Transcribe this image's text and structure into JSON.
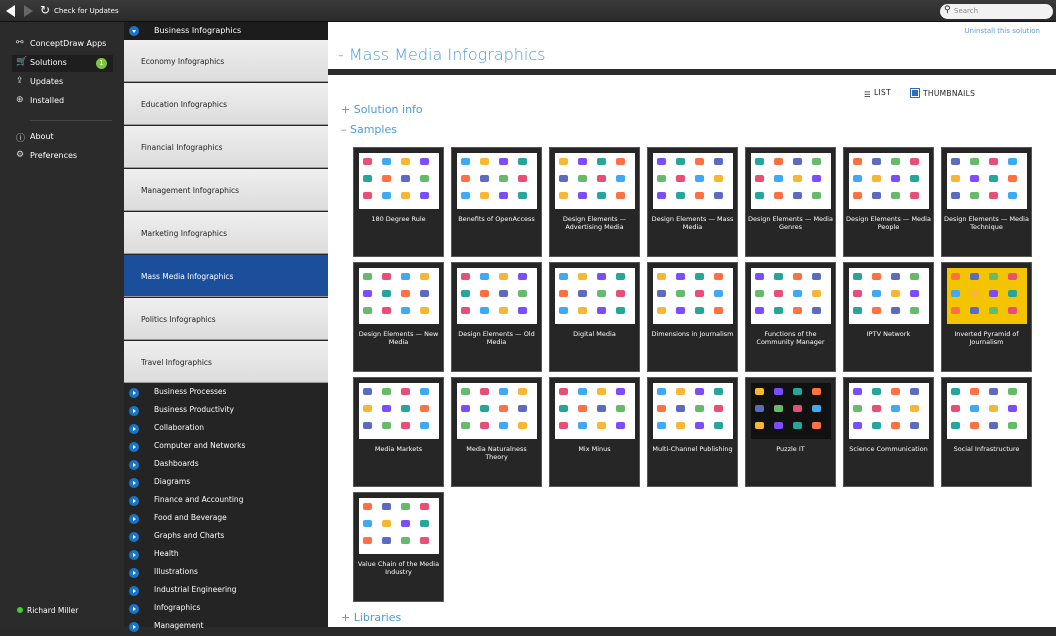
{
  "toolbar": {
    "check_updates": "Check for Updates",
    "search_placeholder": "Search"
  },
  "nav": {
    "items": [
      {
        "label": "ConceptDraw Apps",
        "icon": "apps-icon"
      },
      {
        "label": "Solutions",
        "icon": "cart-icon",
        "badge": "1"
      },
      {
        "label": "Updates",
        "icon": "updates-icon"
      },
      {
        "label": "Installed",
        "icon": "download-icon"
      },
      {
        "label": "About",
        "icon": "info-icon"
      },
      {
        "label": "Preferences",
        "icon": "gear-icon"
      }
    ],
    "user": "Richard Miller"
  },
  "middle": {
    "group": "Business Infographics",
    "subitems": [
      "Economy Infographics",
      "Education Infographics",
      "Financial Infographics",
      "Management Infographics",
      "Marketing Infographics",
      "Mass Media Infographics",
      "Politics Infographics",
      "Travel Infographics"
    ],
    "selected": 5,
    "categories": [
      "Business Processes",
      "Business Productivity",
      "Collaboration",
      "Computer and Networks",
      "Dashboards",
      "Diagrams",
      "Finance and Accounting",
      "Food and Beverage",
      "Graphs and Charts",
      "Health",
      "Illustrations",
      "Industrial Engineering",
      "Infographics",
      "Management"
    ]
  },
  "main": {
    "uninstall": "Uninstall this solution",
    "title": "- Mass Media Infographics",
    "list_label": "LIST",
    "thumbnails_label": "THUMBNAILS",
    "solution_info": "+  Solution info",
    "samples": "–  Samples",
    "libraries": "+  Libraries",
    "samples_list": [
      "180 Degree Rule",
      "Benefits of OpenAccess",
      "Design Elements — Advertising Media",
      "Design Elements — Mass Media",
      "Design Elements — Media Genres",
      "Design Elements — Media People",
      "Design Elements — Media Technique",
      "Design Elements — New Media",
      "Design Elements — Old Media",
      "Digital Media",
      "Dimensions in Journalism",
      "Functions of the Community Manager",
      "IPTV Network",
      "Inverted Pyramid of Journalism",
      "Media Markets",
      "Media Naturalness Theory",
      "Mix Minus",
      "Multi-Channel Publishing",
      "Puzzle IT",
      "Science Communication",
      "Social Infrastructure",
      "Value Chain of the Media Industry"
    ]
  },
  "colors": {
    "accent": "#4a9ad8",
    "selected": "#1b4f9b",
    "badge": "#7cc63b"
  }
}
